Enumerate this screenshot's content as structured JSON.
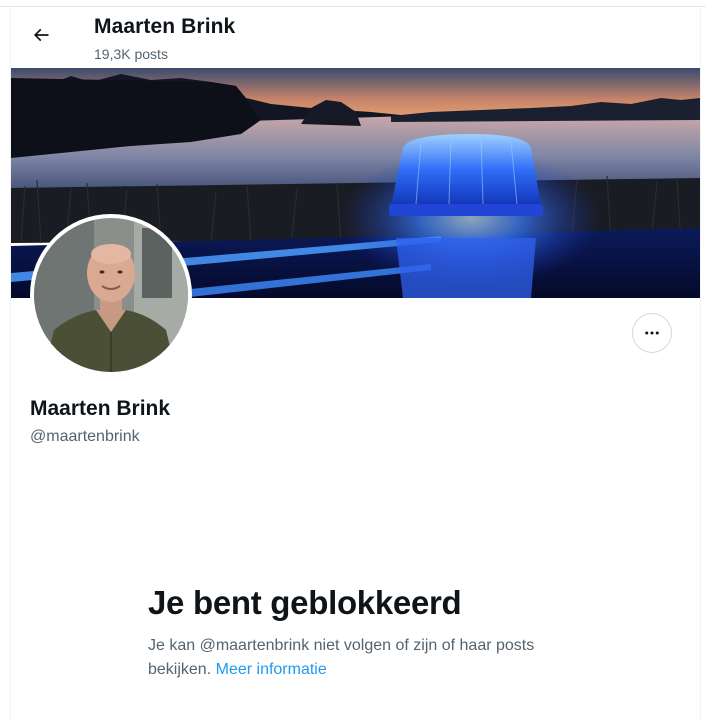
{
  "header": {
    "name": "Maarten Brink",
    "posts": "19,3K posts"
  },
  "profile": {
    "name": "Maarten Brink",
    "handle": "@maartenbrink"
  },
  "blocked": {
    "title": "Je bent geblokkeerd",
    "text": "Je kan @maartenbrink niet volgen of zijn of haar posts bekijken.",
    "link": "Meer informatie"
  },
  "icons": {
    "back": "arrow-left-icon",
    "more": "more-horizontal-icon"
  },
  "colors": {
    "text": "#0f1419",
    "secondary": "#536471",
    "link": "#1d9bf0",
    "border": "#cfd9de"
  }
}
